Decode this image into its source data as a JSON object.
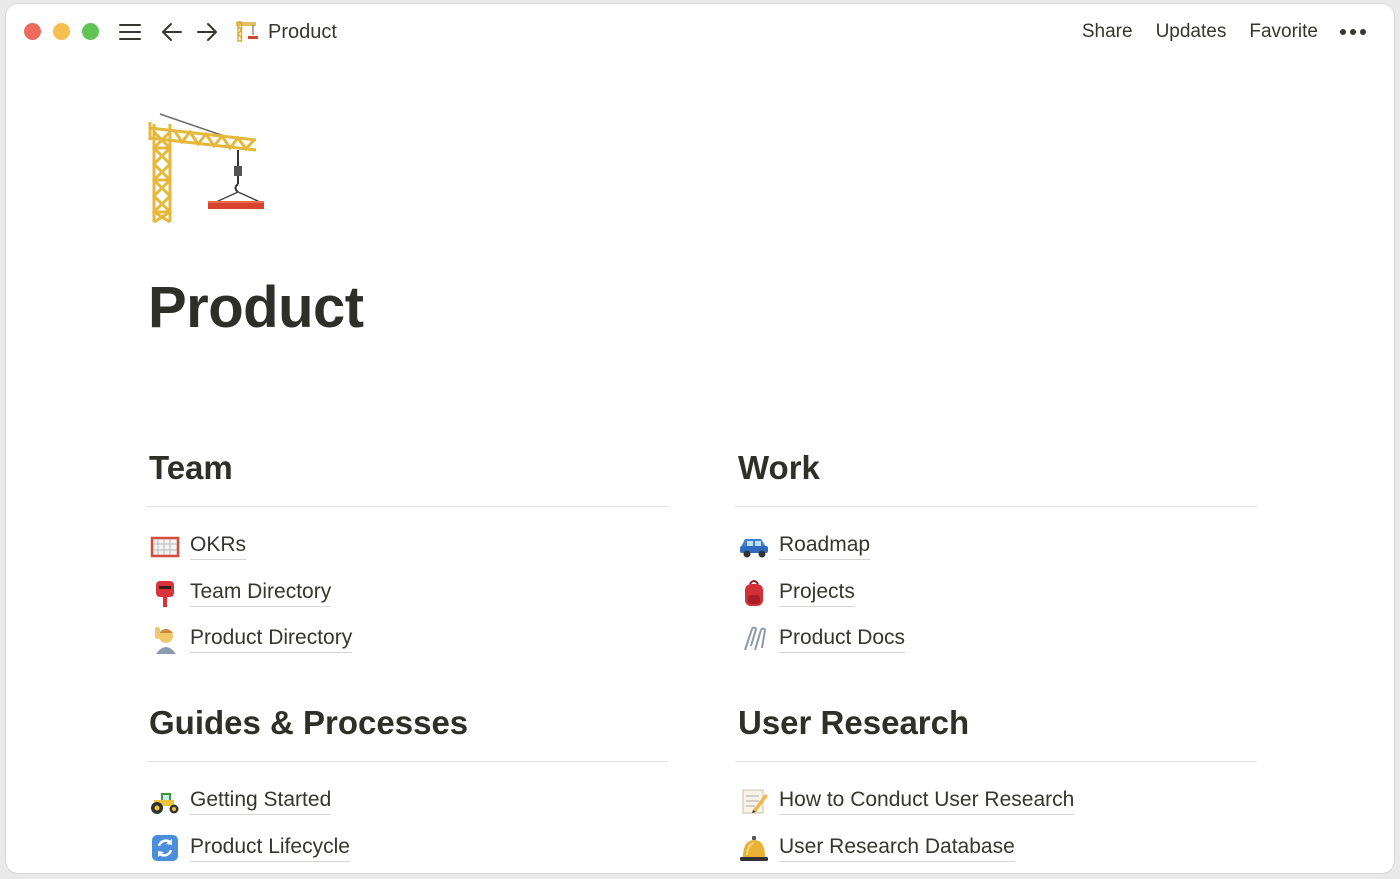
{
  "window": {
    "breadcrumb": {
      "icon": "crane-icon",
      "label": "Product"
    },
    "actions": {
      "share": "Share",
      "updates": "Updates",
      "favorite": "Favorite"
    }
  },
  "page": {
    "icon": "crane-icon",
    "title": "Product"
  },
  "sections": {
    "team": {
      "heading": "Team",
      "links": [
        {
          "icon": "goal-net-icon",
          "label": "OKRs"
        },
        {
          "icon": "postbox-icon",
          "label": "Team Directory"
        },
        {
          "icon": "person-raising-hand-icon",
          "label": "Product Directory"
        }
      ]
    },
    "work": {
      "heading": "Work",
      "links": [
        {
          "icon": "car-icon",
          "label": "Roadmap"
        },
        {
          "icon": "backpack-icon",
          "label": "Projects"
        },
        {
          "icon": "paperclips-icon",
          "label": "Product Docs"
        }
      ]
    },
    "guides": {
      "heading": "Guides & Processes",
      "links": [
        {
          "icon": "tractor-icon",
          "label": "Getting Started"
        },
        {
          "icon": "refresh-icon",
          "label": "Product Lifecycle"
        }
      ]
    },
    "research": {
      "heading": "User Research",
      "links": [
        {
          "icon": "memo-icon",
          "label": "How to Conduct User Research"
        },
        {
          "icon": "bell-icon",
          "label": "User Research Database"
        }
      ]
    }
  }
}
